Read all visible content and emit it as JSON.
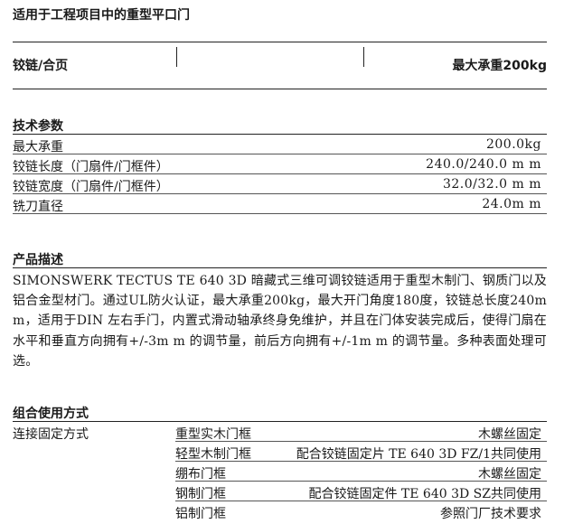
{
  "header": {
    "title": "适用于工程项目中的重型平口门"
  },
  "hinge": {
    "label": "铰链/合页",
    "load": "最大承重200kg"
  },
  "tech": {
    "title": "技术参数",
    "rows": [
      {
        "label": "最大承重",
        "value": "200.0kg"
      },
      {
        "label": "铰链长度（门扇件/门框件）",
        "value": "240.0/240.0 m m"
      },
      {
        "label": "铰链宽度（门扇件/门框件）",
        "value": "32.0/32.0 m m"
      },
      {
        "label": "铣刀直径",
        "value": "24.0m m"
      }
    ]
  },
  "desc": {
    "title": "产品描述",
    "text": "SIMONSWERK TECTUS TE 640 3D 暗藏式三维可调铰链适用于重型木制门、钢质门以及铝合金型材门。通过UL防火认证，最大承重200kg，最大开门角度180度，铰链总长度240m m，适用于DIN 左右手门，内置式滑动轴承终身免维护，并且在门体安装完成后，使得门扇在水平和垂直方向拥有+/-3m m 的调节量，前后方向拥有+/-1m m 的调节量。多种表面处理可选。"
  },
  "combo": {
    "title": "组合使用方式",
    "label": "连接固定方式",
    "rows": [
      {
        "frame": "重型实木门框",
        "method": "木螺丝固定"
      },
      {
        "frame": "轻型木制门框",
        "method": "配合铰链固定片 TE 640 3D FZ/1共同使用"
      },
      {
        "frame": "绷布门框",
        "method": "木螺丝固定"
      },
      {
        "frame": "钢制门框",
        "method": "配合铰链固定件 TE 640 3D SZ共同使用"
      },
      {
        "frame": "铝制门框",
        "method": "参照门厂技术要求"
      }
    ]
  }
}
